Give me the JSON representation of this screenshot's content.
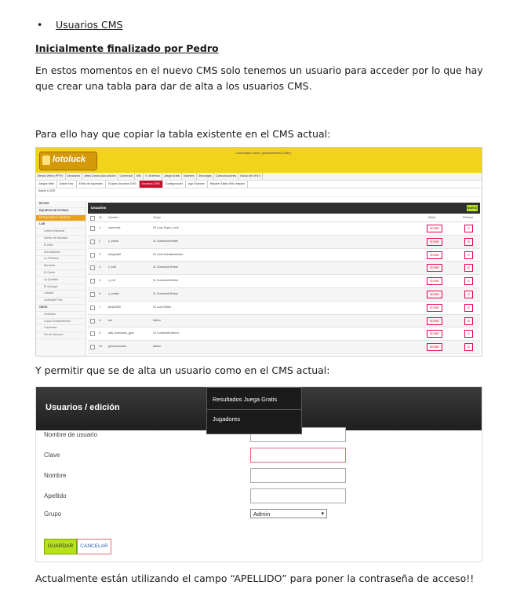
{
  "bullet": {
    "symbol": "•",
    "text": "Usuarios CMS"
  },
  "heading": "Inicialmente finalizado por Pedro",
  "intro": "En estos momentos en el nuevo CMS solo tenemos un usuario para acceder por lo que hay que crear una tabla para dar de alta a los usuarios CMS.",
  "para_copy": "Para ello  hay que copiar la tabla existente en el CMS actual:",
  "para_allow": "Y permitir que se de alta un usuario como en el CMS actual:",
  "para_note": "Actualmente están utilizando el campo “APELLIDO” para poner la contraseña de acceso!!",
  "cms_table": {
    "logo_text": "lotoluck",
    "connected_as": "Conectado como: g3oneservices    [Salir]",
    "nav": [
      "Menús Web y PPVV",
      "Secciones",
      "Otras Zonas Auto-edición",
      "Comercial",
      "Mill.",
      "S. Externos",
      "Juega Gratis",
      "Banners",
      "Descargas",
      "Comunicaciones",
      "Banco de URL's"
    ],
    "subnav": [
      "Juegos Web",
      "Admin Nav",
      "Editor de Apuestas",
      "Grupos Usuarios CMS",
      "Usuarios CMS",
      "Configuración",
      "App Scanner",
      "Reparar Tabla XML relación"
    ],
    "subnav_active": "Usuarios CMS",
    "nav3": "Admin LOGS",
    "sidebar": [
      {
        "t": "BOTES",
        "c": "b"
      },
      {
        "t": "EQUIPOS DE FUTBOL",
        "c": "b"
      },
      {
        "t": "RESULTADOS JUEGOS",
        "c": "o"
      },
      {
        "t": "LAE",
        "c": "b"
      },
      {
        "t": "Lotería Nacional",
        "c": "sub"
      },
      {
        "t": "Sorteo de Navidad",
        "c": "sub"
      },
      {
        "t": "El Niño",
        "c": "sub"
      },
      {
        "t": "Euromillones",
        "c": "sub"
      },
      {
        "t": "La Primitiva",
        "c": "sub"
      },
      {
        "t": "Bonoloto",
        "c": "sub"
      },
      {
        "t": "El Gordo",
        "c": "sub"
      },
      {
        "t": "La Quiniela",
        "c": "sub"
      },
      {
        "t": "El Quinigol",
        "c": "sub"
      },
      {
        "t": "Lototurf",
        "c": "sub"
      },
      {
        "t": "Quintuple Plus",
        "c": "sub"
      },
      {
        "t": "ONCE",
        "c": "b"
      },
      {
        "t": "Ordinario",
        "c": "sub"
      },
      {
        "t": "Cupón Extraordinario",
        "c": "sub"
      },
      {
        "t": "Cuponazo",
        "c": "sub"
      },
      {
        "t": "Fin de Semana",
        "c": "sub"
      }
    ],
    "title": "Usuarios",
    "new_button": "NUEVO",
    "columns": {
      "id": "ID",
      "name": "Nombre",
      "group": "Grupo",
      "edit": "Editar",
      "delete": "Eliminar"
    },
    "rows": [
      {
        "id": "1",
        "name": "superluck",
        "group": "00 Luck Super_Luck"
      },
      {
        "id": "2",
        "name": "c_inordi",
        "group": "11 Comercial Extern"
      },
      {
        "id": "3",
        "name": "amrg1da8",
        "group": "02 Luck Actualizaciones"
      },
      {
        "id": "4",
        "name": "c_ecill",
        "group": "11 Comercial Extern"
      },
      {
        "id": "5",
        "name": "c_eril",
        "group": "11 Comercial Extern"
      },
      {
        "id": "6",
        "name": "c_coetre",
        "group": "11 Comercial Extern"
      },
      {
        "id": "7",
        "name": "pedu2000",
        "group": "01 Luck Editor"
      },
      {
        "id": "8",
        "name": "ser",
        "group": "Admin"
      },
      {
        "id": "9",
        "name": "alta_formulario_jgon",
        "group": "10 Comercial Interno"
      },
      {
        "id": "10",
        "name": "g3oneservices",
        "group": "Admin"
      }
    ],
    "edit_label": "EDITAR",
    "delete_label": "X"
  },
  "form": {
    "title": "Usuarios / edición",
    "menu_items": [
      "Resultados Juega Gratis",
      "Jugadores"
    ],
    "fields": [
      {
        "label": "Nombre de usuario"
      },
      {
        "label": "Clave"
      },
      {
        "label": "Nombre"
      },
      {
        "label": "Apellido"
      }
    ],
    "group_label": "Grupo",
    "group_value": "Admin",
    "save_label": "GUARDAR",
    "cancel_label": "CANCELAR"
  }
}
